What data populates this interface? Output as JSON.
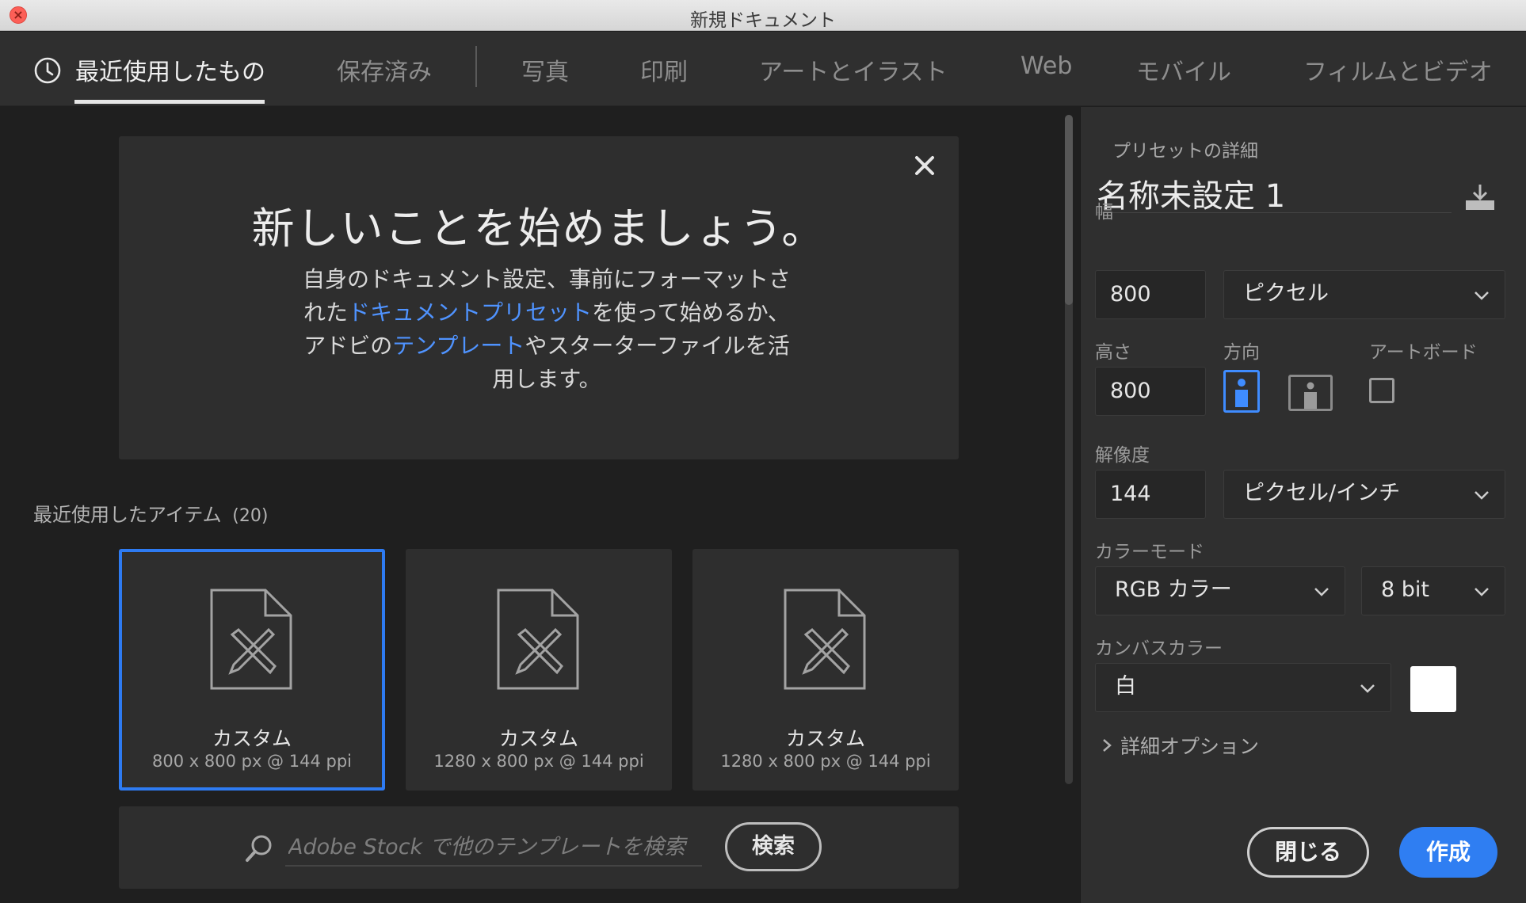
{
  "window": {
    "title": "新規ドキュメント"
  },
  "tabs": [
    {
      "label": "最近使用したもの",
      "active": true
    },
    {
      "label": "保存済み"
    },
    {
      "label": "写真"
    },
    {
      "label": "印刷"
    },
    {
      "label": "アートとイラスト"
    },
    {
      "label": "Web"
    },
    {
      "label": "モバイル"
    },
    {
      "label": "フィルムとビデオ"
    }
  ],
  "welcome": {
    "title": "新しいことを始めましょう。",
    "desc_part1": "自身のドキュメント設定、事前にフォーマットされた",
    "desc_link1": "ドキュメントプリセット",
    "desc_part2": "を使って始めるか、アドビの",
    "desc_link2": "テンプレート",
    "desc_part3": "やスターターファイルを活用します。"
  },
  "recent": {
    "heading": "最近使用したアイテム",
    "count": "(20)",
    "items": [
      {
        "name": "カスタム",
        "dims": "800 x 800 px @ 144 ppi",
        "selected": true
      },
      {
        "name": "カスタム",
        "dims": "1280 x 800 px @ 144 ppi"
      },
      {
        "name": "カスタム",
        "dims": "1280 x 800 px @ 144 ppi"
      }
    ]
  },
  "stock_search": {
    "placeholder": "Adobe Stock で他のテンプレートを検索",
    "button": "検索"
  },
  "preset": {
    "heading": "プリセットの詳細",
    "doc_name": "名称未設定 1",
    "width_label": "幅",
    "width_value": "800",
    "width_unit": "ピクセル",
    "height_label": "高さ",
    "height_value": "800",
    "orientation_label": "方向",
    "orientation": "portrait",
    "artboard_label": "アートボード",
    "artboard_checked": false,
    "resolution_label": "解像度",
    "resolution_value": "144",
    "resolution_unit": "ピクセル/インチ",
    "color_mode_label": "カラーモード",
    "color_mode": "RGB カラー",
    "bit_depth": "8 bit",
    "canvas_color_label": "カンバスカラー",
    "canvas_color": "白",
    "canvas_swatch_color": "#ffffff",
    "advanced_label": "詳細オプション",
    "close_button": "閉じる",
    "create_button": "作成"
  },
  "colors": {
    "accent": "#2f7ef2",
    "link": "#4f93ff"
  }
}
